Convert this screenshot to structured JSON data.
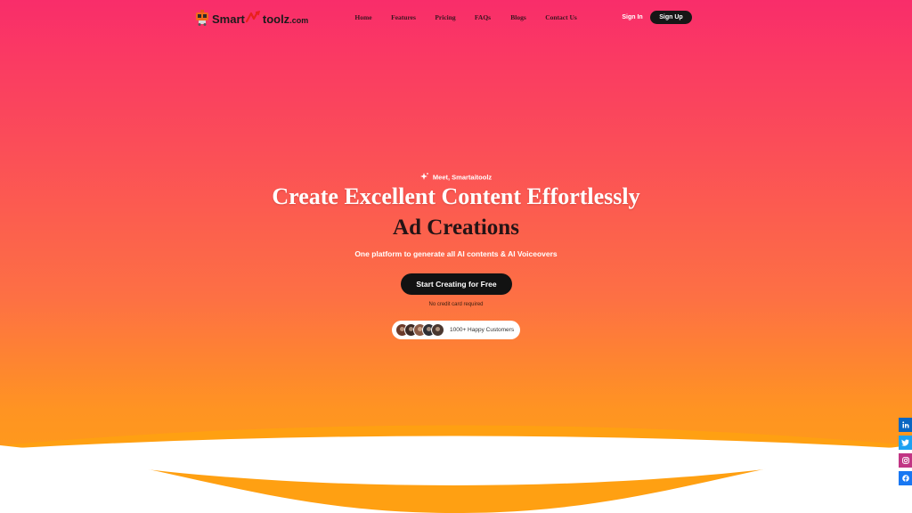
{
  "brand": {
    "name_prefix": "Smart",
    "name_suffix": "toolz",
    "domain": ".com"
  },
  "nav": {
    "items": [
      {
        "label": "Home"
      },
      {
        "label": "Features"
      },
      {
        "label": "Pricing"
      },
      {
        "label": "FAQs"
      },
      {
        "label": "Blogs"
      },
      {
        "label": "Contact Us"
      }
    ],
    "signin_label": "Sign In",
    "signup_label": "Sign Up"
  },
  "hero": {
    "eyebrow": "Meet, Smartaitoolz",
    "title_line1": "Create Excellent Content Effortlessly",
    "title_line2": "Ad Creations",
    "subtitle": "One platform to generate all AI contents & AI Voiceovers",
    "cta_label": "Start Creating for Free",
    "note": "No credit card required",
    "customers_label": "1000+ Happy Customers"
  },
  "social": [
    {
      "icon": "linkedin-icon",
      "color": "#0a66c2"
    },
    {
      "icon": "twitter-icon",
      "color": "#1da1f2"
    },
    {
      "icon": "instagram-icon",
      "color": "#c13584"
    },
    {
      "icon": "facebook-icon",
      "color": "#1877f2"
    }
  ],
  "colors": {
    "gradient_top": "#f92d6a",
    "gradient_bottom": "#ffa012",
    "button_dark": "#121212"
  }
}
